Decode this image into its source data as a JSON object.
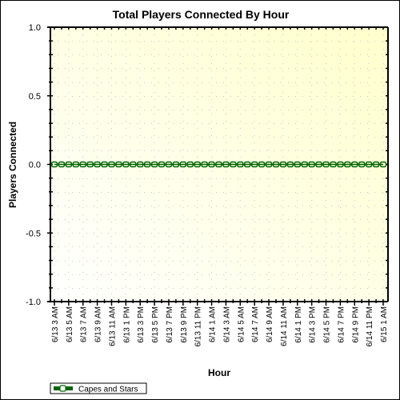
{
  "chart_data": {
    "type": "line",
    "title": "Total Players Connected By Hour",
    "xlabel": "Hour",
    "ylabel": "Players Connected",
    "ylim": [
      -1.0,
      1.0
    ],
    "yticks": [
      "1.0",
      "0.5",
      "0.0",
      "-0.5",
      "-1.0"
    ],
    "ytick_values": [
      1.0,
      0.5,
      0.0,
      -0.5,
      -1.0
    ],
    "xtick_labels": [
      "6/13 3 AM",
      "6/13 5 AM",
      "6/13 7 AM",
      "6/13 9 AM",
      "6/13 11 AM",
      "6/13 1 PM",
      "6/13 3 PM",
      "6/13 5 PM",
      "6/13 7 PM",
      "6/13 9 PM",
      "6/13 11 PM",
      "6/14 1 AM",
      "6/14 3 AM",
      "6/14 5 AM",
      "6/14 7 AM",
      "6/14 9 AM",
      "6/14 11 AM",
      "6/14 1 PM",
      "6/14 3 PM",
      "6/14 5 PM",
      "6/14 7 PM",
      "6/14 9 PM",
      "6/14 11 PM",
      "6/15 1 AM"
    ],
    "grid": true,
    "legend_position": "bottom-left",
    "series": [
      {
        "name": "Capes and Stars",
        "color": "#006400",
        "x_start": "6/13 3 AM",
        "x_end": "6/15 1 AM",
        "interval": "1 hour",
        "values": [
          0,
          0,
          0,
          0,
          0,
          0,
          0,
          0,
          0,
          0,
          0,
          0,
          0,
          0,
          0,
          0,
          0,
          0,
          0,
          0,
          0,
          0,
          0,
          0,
          0,
          0,
          0,
          0,
          0,
          0,
          0,
          0,
          0,
          0,
          0,
          0,
          0,
          0,
          0,
          0,
          0,
          0,
          0,
          0,
          0,
          0,
          0
        ]
      }
    ]
  },
  "colors": {
    "plot_bg_light": "#ffffff",
    "plot_bg_dark": "#ffffcc",
    "grid": "#c8c8c8",
    "series": "#006400"
  }
}
